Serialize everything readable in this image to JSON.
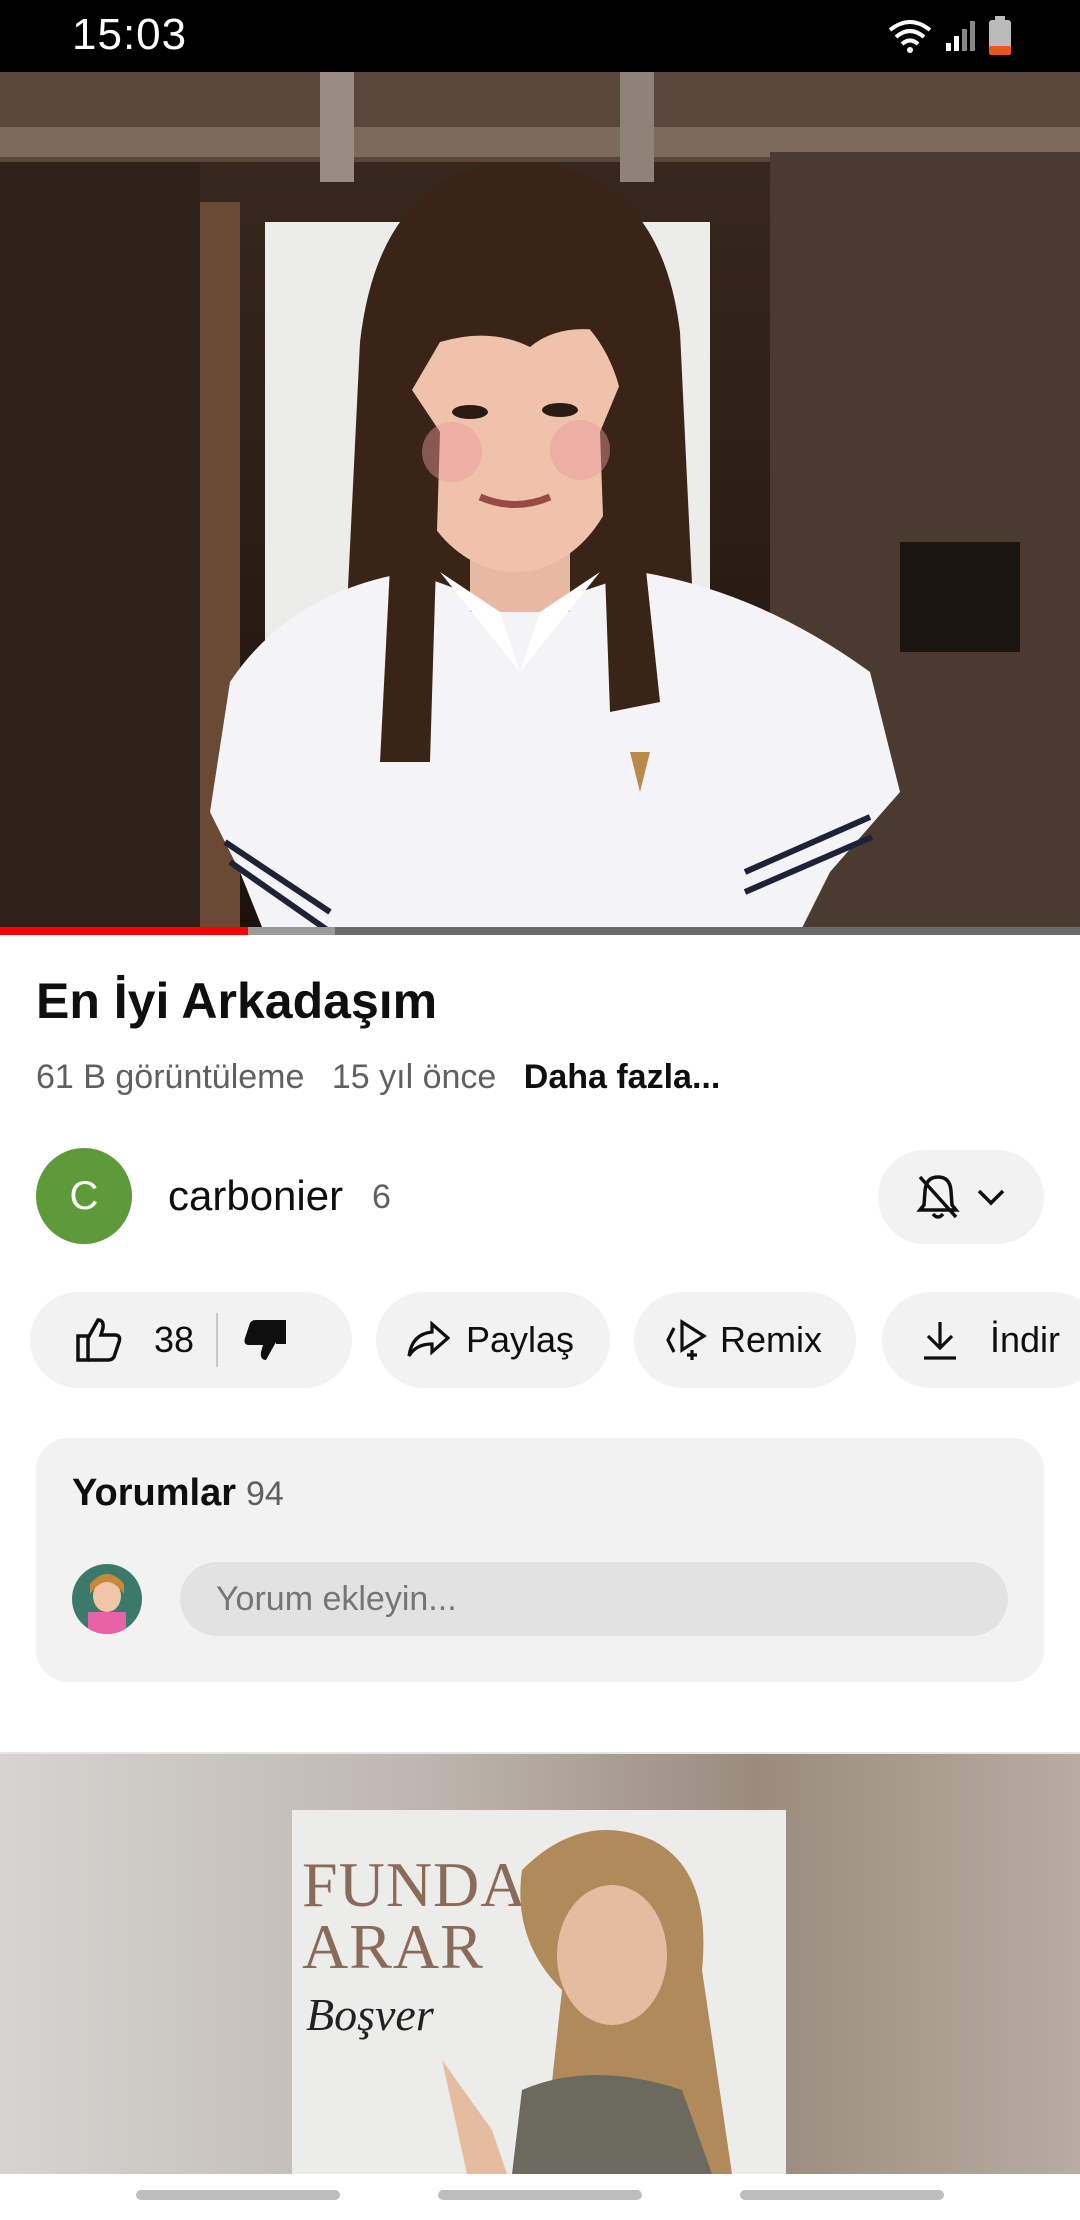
{
  "status_bar": {
    "time": "15:03"
  },
  "video": {
    "title": "En İyi Arkadaşım",
    "progress_fraction": 0.23,
    "buffered_fraction": 0.31
  },
  "meta": {
    "views": "61 B görüntüleme",
    "age": "15 yıl önce",
    "more": "Daha fazla..."
  },
  "channel": {
    "avatar_letter": "C",
    "name": "carbonier",
    "subscribers": "6"
  },
  "actions": {
    "like_count": "38",
    "share": "Paylaş",
    "remix": "Remix",
    "download": "İndir"
  },
  "comments": {
    "title": "Yorumlar",
    "count": "94",
    "placeholder": "Yorum ekleyin..."
  },
  "next_video": {
    "album_line1": "FUNDA",
    "album_line2": "ARAR",
    "album_script": "Boşver"
  },
  "colors": {
    "accent": "#ff0000",
    "channel_avatar": "#5f9a3a"
  }
}
